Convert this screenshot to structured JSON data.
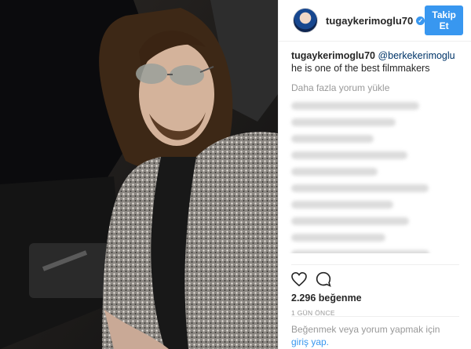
{
  "post": {
    "username": "tugaykerimoglu70",
    "follow_label": "Takip Et",
    "caption_user": "tugaykerimoglu70",
    "caption_mention": "@berkekerimoglu",
    "caption_text": "he is one of the best filmmakers",
    "load_more": "Daha fazla yorum yükle",
    "likes": "2.296 beğenme",
    "time": "1 GÜN ÖNCE",
    "login_text": "Beğenmek veya yorum yapmak için",
    "login_link": "giriş yap."
  },
  "icons": [
    "heart-icon",
    "comment-icon",
    "verified-icon"
  ],
  "colors": {
    "accent": "#3897f0",
    "text": "#262626",
    "muted": "#999999"
  }
}
